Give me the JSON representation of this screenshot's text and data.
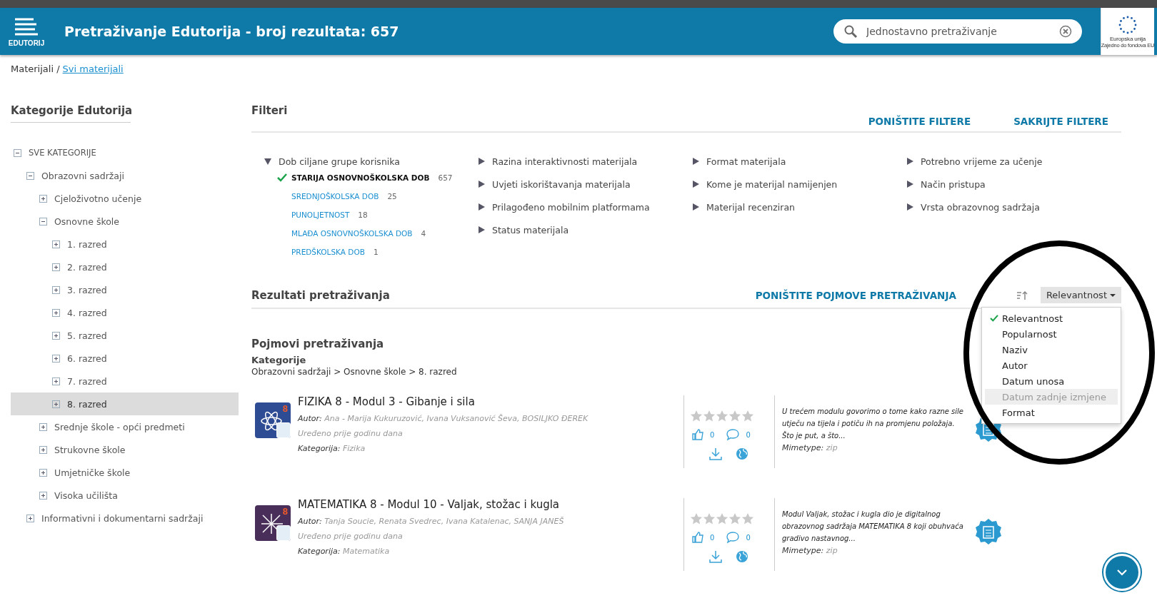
{
  "header": {
    "logo_text": "EDUTORIJ",
    "title": "Pretraživanje Edutorija - broj rezultata: 657",
    "search": {
      "placeholder": "Jednostavno pretraživanje"
    },
    "eu_logo": {
      "line_1": "Europska unija",
      "line_2": "Zajedno do fondova EU"
    }
  },
  "breadcrumb": {
    "current": "Materijali",
    "separator": "/",
    "link": "Svi materijali"
  },
  "sidebar": {
    "title": "Kategorije Edutorija",
    "tree": [
      {
        "label": "SVE KATEGORIJE",
        "expanded": true,
        "selected": false,
        "children": [
          {
            "label": "Obrazovni sadržaji",
            "expanded": true,
            "selected": false,
            "children": [
              {
                "label": "Cjeloživotno učenje",
                "expanded": false,
                "selected": false
              },
              {
                "label": "Osnovne škole",
                "expanded": true,
                "selected": false,
                "children": [
                  {
                    "label": "1. razred",
                    "expanded": false,
                    "selected": false
                  },
                  {
                    "label": "2. razred",
                    "expanded": false,
                    "selected": false
                  },
                  {
                    "label": "3. razred",
                    "expanded": false,
                    "selected": false
                  },
                  {
                    "label": "4. razred",
                    "expanded": false,
                    "selected": false
                  },
                  {
                    "label": "5. razred",
                    "expanded": false,
                    "selected": false
                  },
                  {
                    "label": "6. razred",
                    "expanded": false,
                    "selected": false
                  },
                  {
                    "label": "7. razred",
                    "expanded": false,
                    "selected": false
                  },
                  {
                    "label": "8. razred",
                    "expanded": false,
                    "selected": true
                  }
                ]
              },
              {
                "label": "Srednje škole - opći predmeti",
                "expanded": false,
                "selected": false
              },
              {
                "label": "Strukovne škole",
                "expanded": false,
                "selected": false
              },
              {
                "label": "Umjetničke škole",
                "expanded": false,
                "selected": false
              },
              {
                "label": "Visoka učilišta",
                "expanded": false,
                "selected": false
              }
            ]
          },
          {
            "label": "Informativni i dokumentarni sadržaji",
            "expanded": false,
            "selected": false
          }
        ]
      }
    ]
  },
  "filters": {
    "title": "Filteri",
    "reset_link": "PONIŠTITE FILTERE",
    "hide_link": "SAKRIJTE FILTERE",
    "columns": [
      {
        "groups": [
          {
            "label": "Dob ciljane grupe korisnika",
            "expanded": true,
            "options": [
              {
                "label": "STARIJA OSNOVNOŠKOLSKA DOB",
                "count": "657",
                "selected": true
              },
              {
                "label": "SREDNJOŠKOLSKA DOB",
                "count": "25",
                "selected": false
              },
              {
                "label": "PUNOLJETNOST",
                "count": "18",
                "selected": false
              },
              {
                "label": "MLAĐA OSNOVNOŠKOLSKA DOB",
                "count": "4",
                "selected": false
              },
              {
                "label": "PREDŠKOLSKA DOB",
                "count": "1",
                "selected": false
              }
            ]
          }
        ]
      },
      {
        "groups": [
          {
            "label": "Razina interaktivnosti materijala",
            "expanded": false
          },
          {
            "label": "Uvjeti iskorištavanja materijala",
            "expanded": false
          },
          {
            "label": "Prilagođeno mobilnim platformama",
            "expanded": false
          },
          {
            "label": "Status materijala",
            "expanded": false
          }
        ]
      },
      {
        "groups": [
          {
            "label": "Format materijala",
            "expanded": false
          },
          {
            "label": "Kome je materijal namijenjen",
            "expanded": false
          },
          {
            "label": "Materijal recenziran",
            "expanded": false
          }
        ]
      },
      {
        "groups": [
          {
            "label": "Potrebno vrijeme za učenje",
            "expanded": false
          },
          {
            "label": "Način pristupa",
            "expanded": false
          },
          {
            "label": "Vrsta obrazovnog sadržaja",
            "expanded": false
          }
        ]
      }
    ]
  },
  "results": {
    "title": "Rezultati pretraživanja",
    "reset_terms_link": "PONIŠTITE POJMOVE PRETRAŽIVANJA",
    "sort": {
      "value": "Relevantnost",
      "options": [
        {
          "label": "Relevantnost",
          "selected": true,
          "highlighted": false
        },
        {
          "label": "Popularnost",
          "selected": false,
          "highlighted": false
        },
        {
          "label": "Naziv",
          "selected": false,
          "highlighted": false
        },
        {
          "label": "Autor",
          "selected": false,
          "highlighted": false
        },
        {
          "label": "Datum unosa",
          "selected": false,
          "highlighted": false
        },
        {
          "label": "Datum zadnje izmjene",
          "selected": false,
          "highlighted": true
        },
        {
          "label": "Format",
          "selected": false,
          "highlighted": false
        }
      ]
    },
    "terms_title": "Pojmovi pretraživanja",
    "category_label": "Kategorije",
    "category_path": "Obrazovni sadržaji > Osnovne škole > 8. razred",
    "items": [
      {
        "title": "FIZIKA 8 - Modul 3 - Gibanje i sila",
        "author_label": "Autor:",
        "authors": "Ana - Marija Kukuruzović, Ivana Vuksanović Ševa, BOSILJKO ĐEREK",
        "edited": "Uređeno prije godinu dana",
        "category_label": "Kategorija:",
        "category": "Fizika",
        "thumbnail_mark": "8",
        "stars": 0,
        "likes": "0",
        "comments": "0",
        "description": "U trećem modulu govorimo o tome kako razne sile utječu na tijela i potiču ih na promjenu položaja. Što je put, a što...",
        "mimetype_label": "Mimetype:",
        "mimetype": "zip",
        "kind": "physics"
      },
      {
        "title": "MATEMATIKA 8 - Modul 10 - Valjak, stožac i kugla",
        "author_label": "Autor:",
        "authors": "Tanja Soucie, Renata Svedrec, Ivana Katalenac, SANJA JANEŠ",
        "edited": "Uređeno prije godinu dana",
        "category_label": "Kategorija:",
        "category": "Matematika",
        "thumbnail_mark": "8",
        "stars": 0,
        "likes": "0",
        "comments": "0",
        "description": "Modul Valjak, stožac i kugla dio je digitalnog obrazovnog sadržaja MATEMATIKA 8 koji obuhvaća gradivo nastavnog...",
        "mimetype_label": "Mimetype:",
        "mimetype": "zip",
        "kind": "math"
      }
    ]
  }
}
